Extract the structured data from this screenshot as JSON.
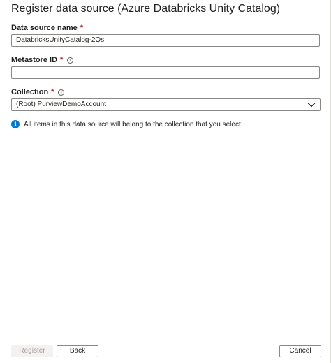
{
  "panel": {
    "title": "Register data source (Azure Databricks Unity Catalog)"
  },
  "fields": {
    "data_source_name": {
      "label": "Data source name",
      "required_mark": "*",
      "value": "DatabricksUnityCatalog-2Qs"
    },
    "metastore_id": {
      "label": "Metastore ID",
      "required_mark": "*",
      "info_icon": "info-outline-icon",
      "value": ""
    },
    "collection": {
      "label": "Collection",
      "required_mark": "*",
      "info_icon": "info-outline-icon",
      "selected": "(Root) PurviewDemoAccount"
    }
  },
  "info_message": {
    "icon": "info-filled-icon",
    "text": "All items in this data source will belong to the collection that you select."
  },
  "footer": {
    "register_label": "Register",
    "register_disabled": true,
    "back_label": "Back",
    "cancel_label": "Cancel"
  },
  "colors": {
    "accent": "#0078d4",
    "required": "#a4262c",
    "border": "#8a8886",
    "disabled_bg": "#f3f2f1",
    "disabled_text": "#a19f9d"
  }
}
